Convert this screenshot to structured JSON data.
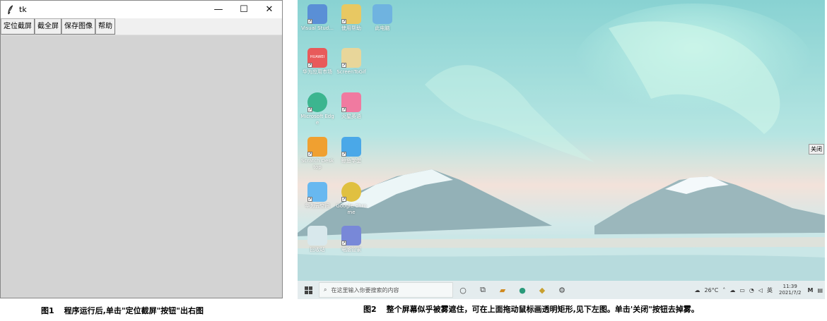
{
  "figure1": {
    "window_title": "tk",
    "controls": {
      "minimize": "—",
      "maximize": "☐",
      "close": "✕"
    },
    "buttons": [
      "定位截屏",
      "截全屏",
      "保存图像",
      "帮助"
    ],
    "caption_num": "图1",
    "caption_text": "程序运行后,单击\"定位截屏\"按钮\"出右图"
  },
  "figure2": {
    "desktop_icons": [
      {
        "label": "Visual Stud...",
        "color": "#5a8fd6"
      },
      {
        "label": "使用帮助",
        "color": "#e8c862"
      },
      {
        "label": "此电脑",
        "color": "#6fb3e0"
      },
      {
        "label": "华为应用市场",
        "color": "#e85a5a"
      },
      {
        "label": "ScreenToGif",
        "color": "#e8d69a"
      },
      {
        "label": "Microsoft Edge",
        "color": "#3cb58f"
      },
      {
        "label": "火星英语",
        "color": "#f07aa0"
      },
      {
        "label": "Scratch Desktop",
        "color": "#f0a030"
      },
      {
        "label": "鲸鱼学堂",
        "color": "#4aa8e8"
      },
      {
        "label": "华为云空间",
        "color": "#68b8f0"
      },
      {
        "label": "Google Chrome",
        "color": "#e0c040"
      },
      {
        "label": "回收站",
        "color": "#d8e8ec"
      },
      {
        "label": "电脑管家",
        "color": "#7888d8"
      }
    ],
    "huawei_badge": "HUAWEI",
    "close_button": "关闭",
    "taskbar": {
      "search_placeholder": "在这里输入你要搜索的内容",
      "weather": "26°C",
      "ime": "英",
      "time": "11:39",
      "date": "2021/7/2"
    },
    "caption_num": "图2",
    "caption_text": "整个屏幕似乎被雾遮住，可在上面拖动鼠标画透明矩形,见下左图。单击'关闭\"按钮去掉雾。"
  }
}
